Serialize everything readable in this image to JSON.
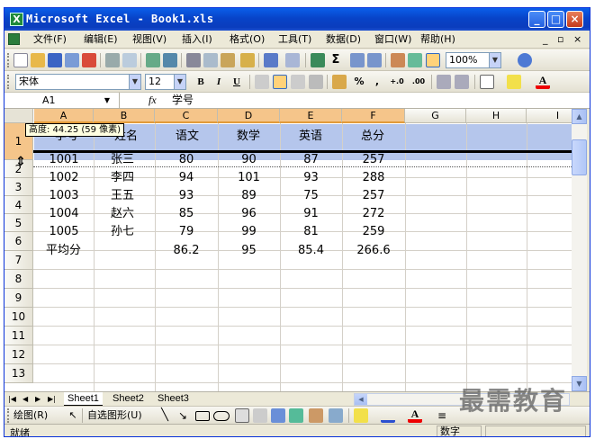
{
  "window": {
    "title": "Microsoft Excel - Book1.xls"
  },
  "menu": {
    "items": [
      "文件(F)",
      "编辑(E)",
      "视图(V)",
      "插入(I)",
      "格式(O)",
      "工具(T)",
      "数据(D)",
      "窗口(W)",
      "帮助(H)"
    ],
    "mdi_controls": [
      "_",
      "▫",
      "×"
    ]
  },
  "toolbar_standard": {
    "zoom": "100%"
  },
  "toolbar_format": {
    "font_name": "宋体",
    "font_size": "12",
    "bold": "B",
    "italic": "I",
    "underline": "U",
    "percent": "%",
    "comma": ",",
    "inc_decimal": "+.0",
    "dec_decimal": ".00"
  },
  "formula_bar": {
    "name_box": "A1",
    "fx": "fx",
    "content": "学号"
  },
  "columns": [
    "A",
    "B",
    "C",
    "D",
    "E",
    "F",
    "G",
    "H",
    "I"
  ],
  "rows": [
    "1",
    "2",
    "3",
    "4",
    "5",
    "6",
    "7",
    "8",
    "9",
    "10",
    "11",
    "12",
    "13"
  ],
  "tooltip": "高度: 44.25 (59 像素)",
  "sheet": {
    "header": [
      "学号",
      "姓名",
      "语文",
      "数学",
      "英语",
      "总分"
    ],
    "data": [
      [
        "1001",
        "张三",
        "80",
        "90",
        "87",
        "257"
      ],
      [
        "1002",
        "李四",
        "94",
        "101",
        "93",
        "288"
      ],
      [
        "1003",
        "王五",
        "93",
        "89",
        "75",
        "257"
      ],
      [
        "1004",
        "赵六",
        "85",
        "96",
        "91",
        "272"
      ],
      [
        "1005",
        "孙七",
        "79",
        "99",
        "81",
        "259"
      ],
      [
        "平均分",
        "",
        "86.2",
        "95",
        "85.4",
        "266.6"
      ]
    ]
  },
  "sheet_tabs": [
    "Sheet1",
    "Sheet2",
    "Sheet3"
  ],
  "drawing": {
    "draw_label": "绘图(R)",
    "autoshapes_label": "自选图形(U)"
  },
  "status": {
    "ready": "就绪",
    "num": "数字"
  },
  "watermark": "最需教育",
  "colors": {
    "title_bar": "#0a4fd8",
    "selected_header": "#f5c58a",
    "selection_band": "#b5c6ec"
  }
}
